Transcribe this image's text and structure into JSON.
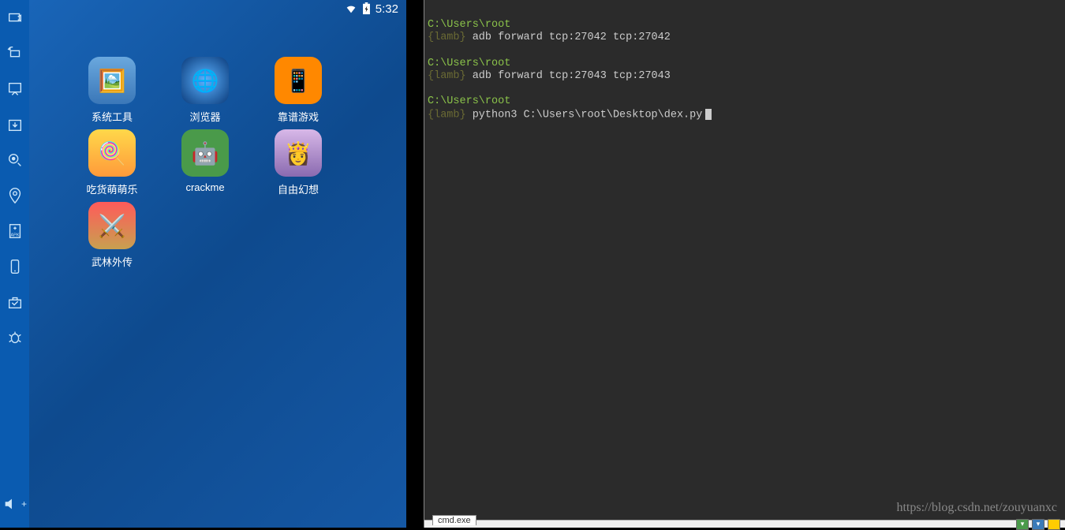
{
  "status": {
    "time": "5:32"
  },
  "apps": [
    {
      "label": "系统工具",
      "bg": "linear-gradient(#6aa8de,#3a77b8)",
      "emoji": "🖼️"
    },
    {
      "label": "浏览器",
      "bg": "radial-gradient(circle,#5db3ff,#0a3a7a)",
      "emoji": "🌐"
    },
    {
      "label": "靠谱游戏",
      "bg": "#ff8800",
      "emoji": "🎮"
    },
    {
      "label": "吃货萌萌乐",
      "bg": "linear-gradient(#ffd84a,#ff9a3a)",
      "emoji": "🍭"
    },
    {
      "label": "crackme",
      "bg": "#4a9a4a",
      "emoji": "🤖"
    },
    {
      "label": "自由幻想",
      "bg": "linear-gradient(#d8b8e8,#8a6ab0)",
      "emoji": "👸"
    },
    {
      "label": "武林外传",
      "bg": "linear-gradient(#8ad4ff,#c8a050)",
      "emoji": "⚔️"
    }
  ],
  "sidebar_icons": [
    "share-icon",
    "rotate-icon",
    "screenshot-icon",
    "download-icon",
    "camera-icon",
    "location-icon",
    "apk-icon",
    "device-icon",
    "toolbox-icon",
    "bug-icon"
  ],
  "volume_label": "+",
  "terminal": {
    "blocks": [
      {
        "path": "C:\\Users\\root",
        "lamb": "{lamb}",
        "cmd": " adb forward tcp:27042 tcp:27042"
      },
      {
        "path": "C:\\Users\\root",
        "lamb": "{lamb}",
        "cmd": " adb forward tcp:27043 tcp:27043"
      },
      {
        "path": "C:\\Users\\root",
        "lamb": "{lamb}",
        "cmd": " python3 C:\\Users\\root\\Desktop\\dex.py"
      }
    ],
    "tab": "cmd.exe",
    "watermark": "https://blog.csdn.net/zouyuanxc"
  }
}
